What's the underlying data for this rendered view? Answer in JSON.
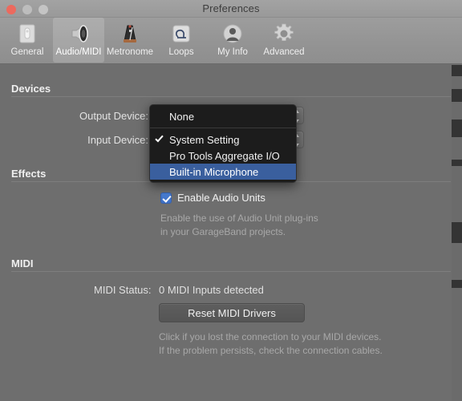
{
  "window": {
    "title": "Preferences",
    "traffic_lights": [
      {
        "name": "close",
        "color": "#ec6a5e"
      },
      {
        "name": "minimize",
        "color": "#bdbdbd"
      },
      {
        "name": "maximize",
        "color": "#c4c4c4"
      }
    ]
  },
  "toolbar": {
    "items": [
      {
        "label": "General",
        "icon": "general-icon",
        "selected": false
      },
      {
        "label": "Audio/MIDI",
        "icon": "speaker-icon",
        "selected": true
      },
      {
        "label": "Metronome",
        "icon": "metronome-icon",
        "selected": false
      },
      {
        "label": "Loops",
        "icon": "loops-icon",
        "selected": false
      },
      {
        "label": "My Info",
        "icon": "person-icon",
        "selected": false
      },
      {
        "label": "Advanced",
        "icon": "gear-icon",
        "selected": false
      }
    ]
  },
  "sections": {
    "devices": {
      "header": "Devices",
      "output_label": "Output Device:",
      "input_label": "Input Device:"
    },
    "effects": {
      "header": "Effects",
      "checkbox_label": "Enable Audio Units",
      "checkbox_checked": true,
      "help_text": "Enable the use of Audio Unit plug-ins\nin your GarageBand projects."
    },
    "midi": {
      "header": "MIDI",
      "status_label": "MIDI Status:",
      "status_value": "0 MIDI Inputs detected",
      "reset_button": "Reset MIDI Drivers",
      "help_text": "Click if you lost the connection to your MIDI devices.\nIf the problem persists, check the connection cables."
    }
  },
  "dropdown": {
    "open": true,
    "highlight_color": "#3a5f9e",
    "items": [
      {
        "label": "None",
        "checked": false,
        "highlighted": false,
        "separator_after": true
      },
      {
        "label": "System Setting",
        "checked": true,
        "highlighted": false,
        "separator_after": false
      },
      {
        "label": "Pro Tools Aggregate I/O",
        "checked": false,
        "highlighted": false,
        "separator_after": false
      },
      {
        "label": "Built-in Microphone",
        "checked": false,
        "highlighted": true,
        "separator_after": false
      }
    ]
  }
}
